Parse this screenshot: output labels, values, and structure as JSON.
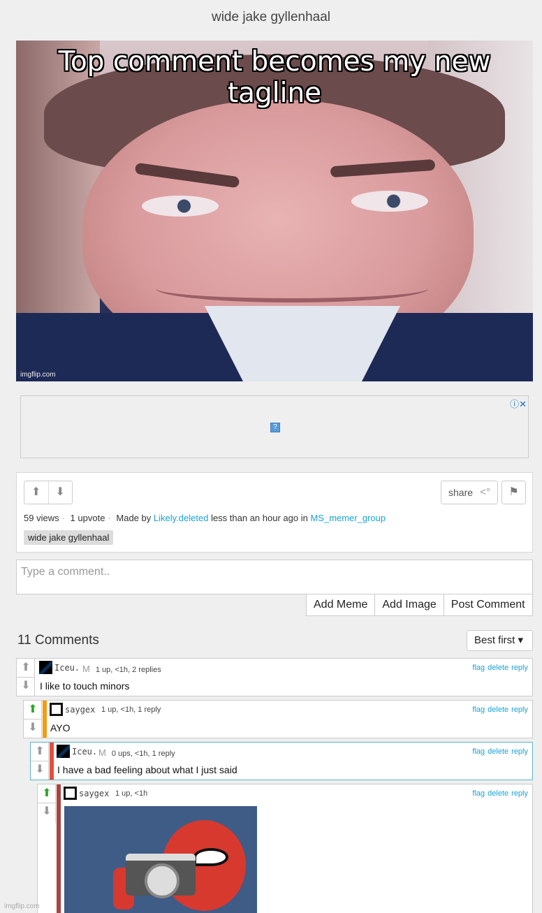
{
  "page_title": "wide jake gyllenhaal",
  "meme": {
    "caption": "Top comment becomes my new tagline",
    "watermark": "imgflip.com"
  },
  "ad": {
    "controls": "ⓘ✕",
    "placeholder": "?"
  },
  "post": {
    "share_label": "share",
    "views": "59 views",
    "upvotes": "1 upvote",
    "made_by_prefix": "Made by",
    "author": "Likely.deleted",
    "time_text": "less than an hour ago in",
    "group": "MS_memer_group",
    "tag": "wide jake gyllenhaal"
  },
  "comment_box": {
    "placeholder": "Type a comment.."
  },
  "buttons": {
    "add_meme": "Add Meme",
    "add_image": "Add Image",
    "post_comment": "Post Comment"
  },
  "comments_header": {
    "count": "11 Comments",
    "sort": "Best first ▾"
  },
  "comments": [
    {
      "user": "Iceu.",
      "badge": "M",
      "info": "1 up, <1h, 2 replies",
      "text": "I like to touch minors",
      "flag": "flag",
      "delete": "delete",
      "reply": "reply"
    },
    {
      "user": "saygex",
      "info": "1 up, <1h, 1 reply",
      "text": "AYO",
      "flag": "flag",
      "delete": "delete",
      "reply": "reply"
    },
    {
      "user": "Iceu.",
      "badge": "M",
      "info": "0 ups, <1h, 1 reply",
      "text": "I have a bad feeling about what I just said",
      "flag": "flag",
      "delete": "delete",
      "reply": "reply"
    },
    {
      "user": "saygex",
      "info": "1 up, <1h",
      "flag": "flag",
      "delete": "delete",
      "reply": "reply"
    }
  ],
  "colors": {
    "link": "#1aa3d6",
    "bar_orange": "#f39c12",
    "bar_red": "#e74c3c",
    "bar_dark_red": "#a94442",
    "upvote_green": "#2aa52a"
  },
  "footer": {
    "watermark": "imgflip.com"
  }
}
